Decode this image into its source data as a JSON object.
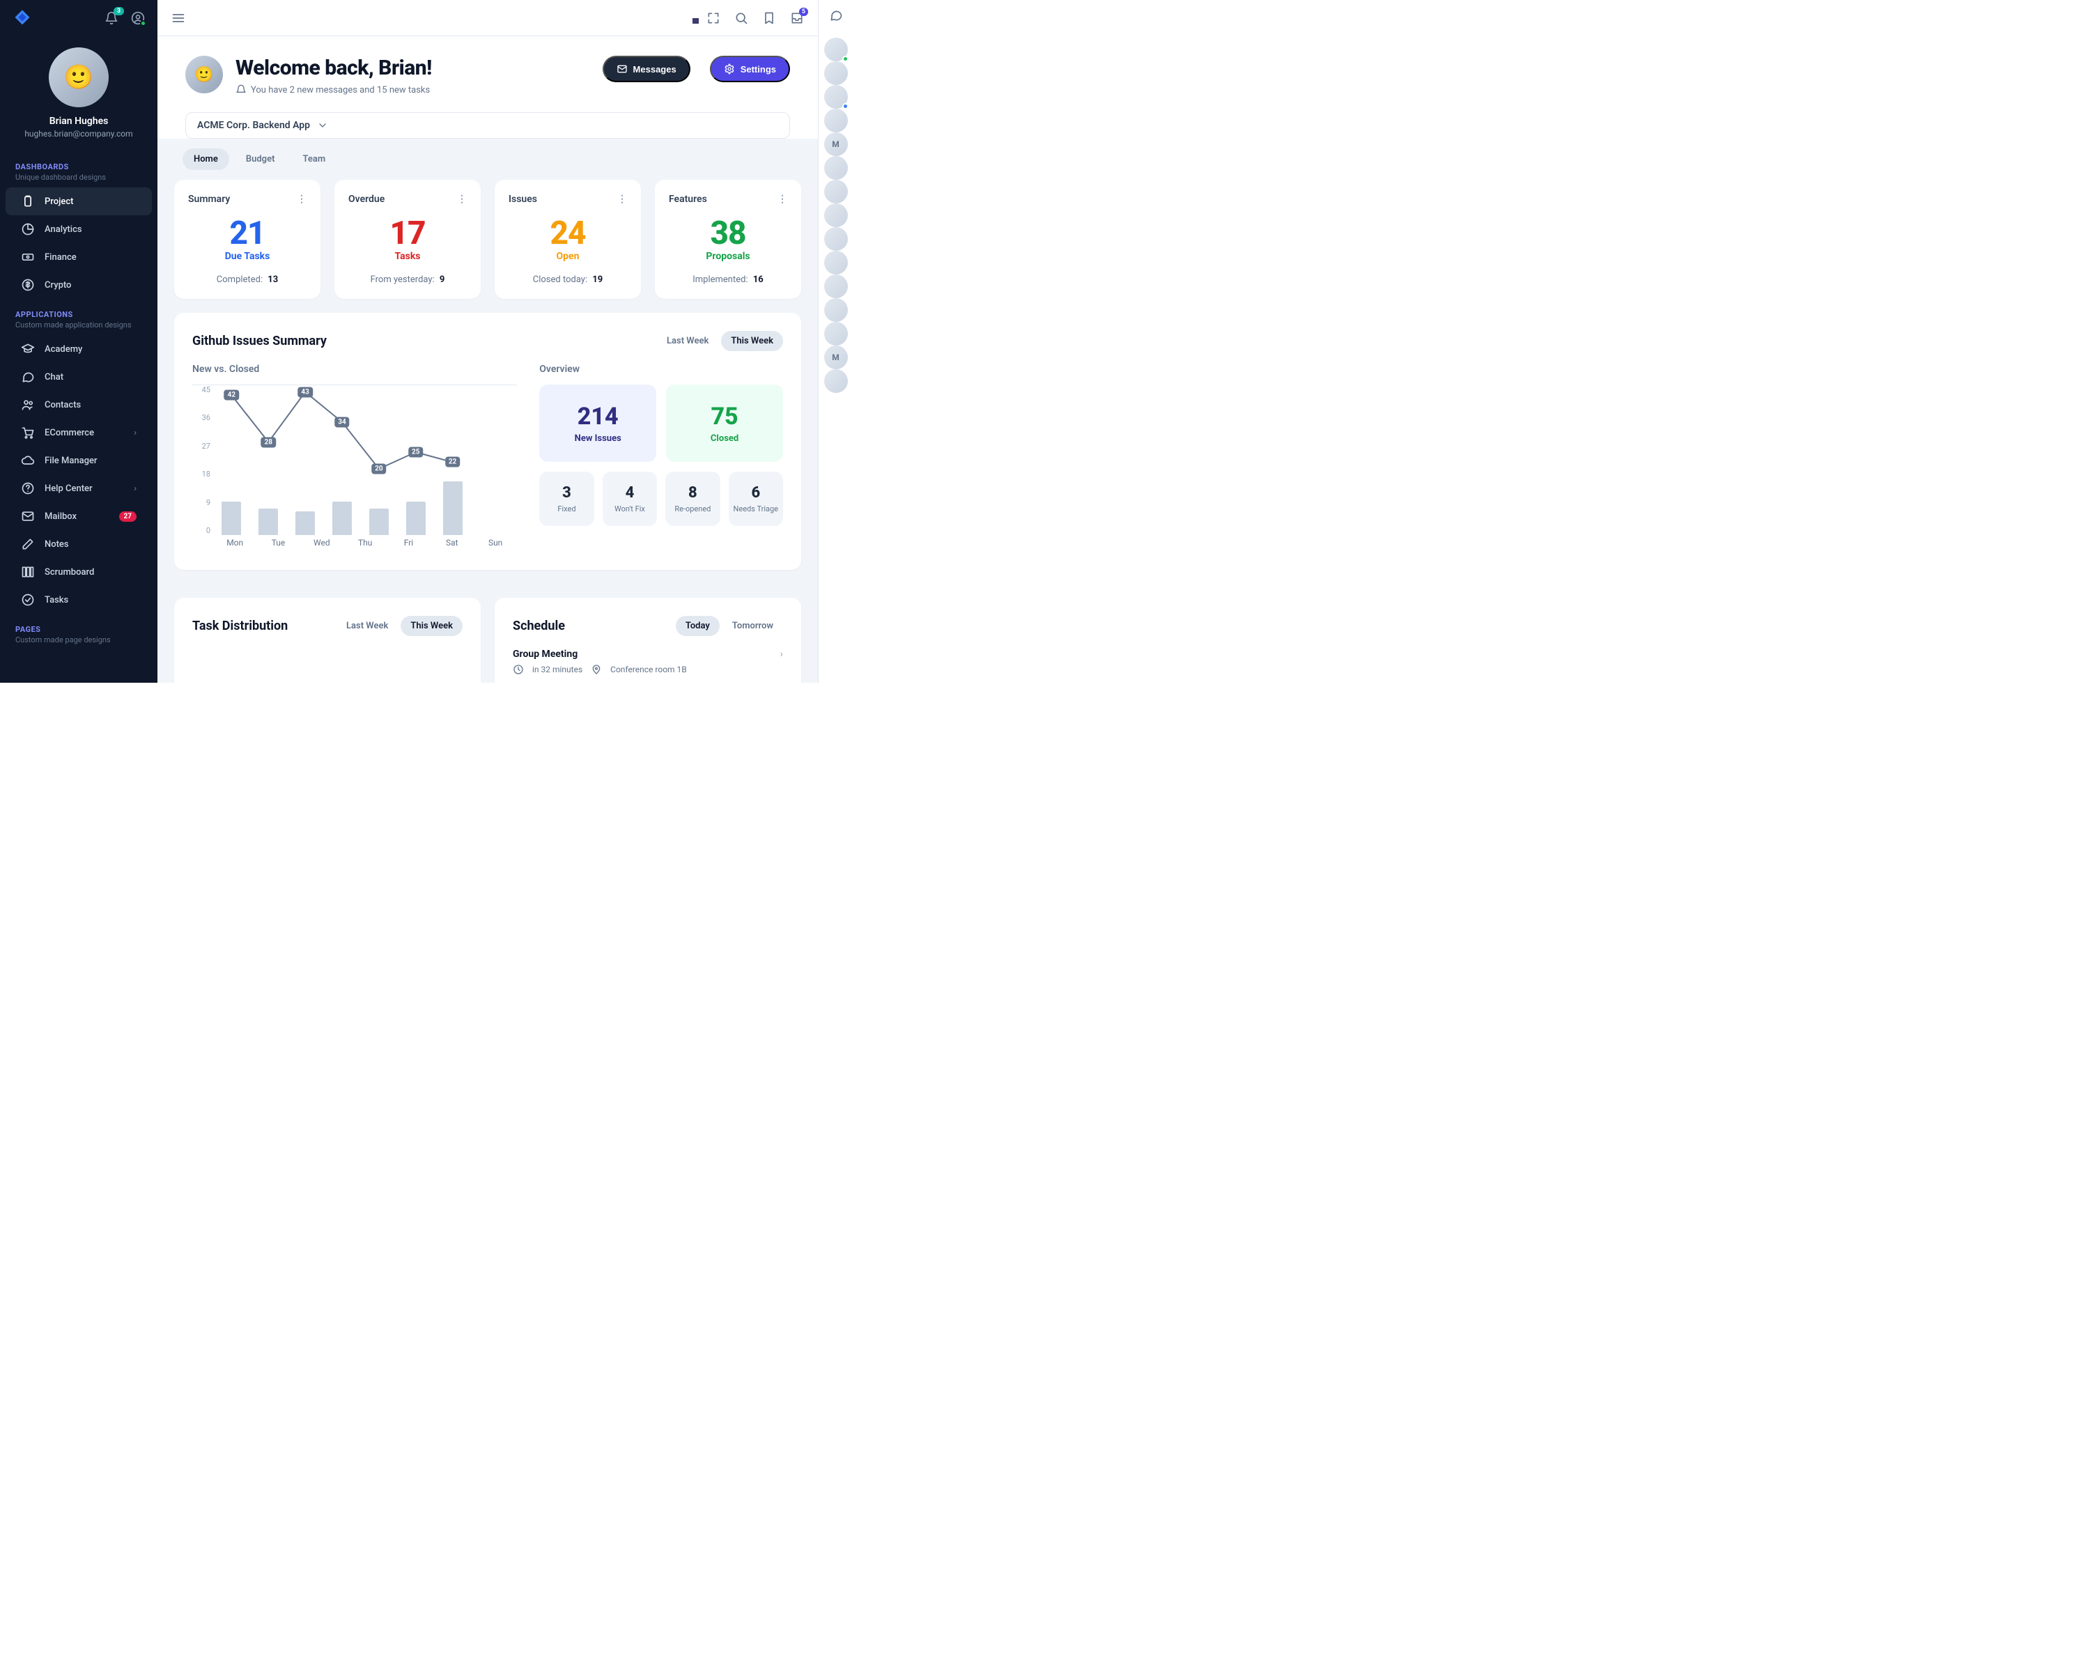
{
  "sidebar": {
    "notif_count": "3",
    "profile": {
      "name": "Brian Hughes",
      "email": "hughes.brian@company.com"
    },
    "sections": [
      {
        "title": "DASHBOARDS",
        "sub": "Unique dashboard designs",
        "items": [
          {
            "label": "Project",
            "icon": "clipboard",
            "active": true
          },
          {
            "label": "Analytics",
            "icon": "pie"
          },
          {
            "label": "Finance",
            "icon": "cash"
          },
          {
            "label": "Crypto",
            "icon": "dollar"
          }
        ]
      },
      {
        "title": "APPLICATIONS",
        "sub": "Custom made application designs",
        "items": [
          {
            "label": "Academy",
            "icon": "cap"
          },
          {
            "label": "Chat",
            "icon": "chat"
          },
          {
            "label": "Contacts",
            "icon": "users"
          },
          {
            "label": "ECommerce",
            "icon": "cart",
            "chev": true
          },
          {
            "label": "File Manager",
            "icon": "cloud"
          },
          {
            "label": "Help Center",
            "icon": "help",
            "chev": true
          },
          {
            "label": "Mailbox",
            "icon": "mail",
            "badge": "27"
          },
          {
            "label": "Notes",
            "icon": "pencil"
          },
          {
            "label": "Scrumboard",
            "icon": "columns"
          },
          {
            "label": "Tasks",
            "icon": "check"
          }
        ]
      },
      {
        "title": "PAGES",
        "sub": "Custom made page designs",
        "items": []
      }
    ]
  },
  "topbar": {
    "inbox_badge": "5"
  },
  "header": {
    "title": "Welcome back, Brian!",
    "sub": "You have 2 new messages and 15 new tasks",
    "messages_btn": "Messages",
    "settings_btn": "Settings",
    "project_selector": "ACME Corp. Backend App"
  },
  "tabs": [
    "Home",
    "Budget",
    "Team"
  ],
  "summary_cards": [
    {
      "title": "Summary",
      "value": "21",
      "label": "Due Tasks",
      "foot_label": "Completed:",
      "foot_value": "13",
      "color": "c-blue"
    },
    {
      "title": "Overdue",
      "value": "17",
      "label": "Tasks",
      "foot_label": "From yesterday:",
      "foot_value": "9",
      "color": "c-red"
    },
    {
      "title": "Issues",
      "value": "24",
      "label": "Open",
      "foot_label": "Closed today:",
      "foot_value": "19",
      "color": "c-amber"
    },
    {
      "title": "Features",
      "value": "38",
      "label": "Proposals",
      "foot_label": "Implemented:",
      "foot_value": "16",
      "color": "c-green"
    }
  ],
  "github": {
    "title": "Github Issues Summary",
    "toggle": [
      "Last Week",
      "This Week"
    ],
    "chart_title": "New vs. Closed",
    "overview_title": "Overview",
    "overview": {
      "new_issues": {
        "n": "214",
        "l": "New Issues"
      },
      "closed": {
        "n": "75",
        "l": "Closed"
      },
      "small": [
        {
          "n": "3",
          "l": "Fixed"
        },
        {
          "n": "4",
          "l": "Won't Fix"
        },
        {
          "n": "8",
          "l": "Re-opened"
        },
        {
          "n": "6",
          "l": "Needs Triage"
        }
      ]
    }
  },
  "chart_data": {
    "type": "bar+line",
    "categories": [
      "Mon",
      "Tue",
      "Wed",
      "Thu",
      "Fri",
      "Sat",
      "Sun"
    ],
    "y_ticks": [
      45,
      36,
      27,
      18,
      9,
      0
    ],
    "ylim": [
      0,
      45
    ],
    "series": [
      {
        "name": "Closed (bars)",
        "type": "bar",
        "values": [
          10,
          8,
          7,
          10,
          8,
          10,
          16
        ]
      },
      {
        "name": "New (line)",
        "type": "line",
        "values": [
          42,
          28,
          43,
          34,
          20,
          25,
          22
        ]
      }
    ]
  },
  "task_dist": {
    "title": "Task Distribution",
    "toggle": [
      "Last Week",
      "This Week"
    ]
  },
  "schedule": {
    "title": "Schedule",
    "toggle": [
      "Today",
      "Tomorrow"
    ],
    "items": [
      {
        "title": "Group Meeting",
        "time": "in 32 minutes",
        "loc": "Conference room 1B"
      }
    ]
  },
  "rail": [
    {
      "letter": "",
      "presence": "#22c55e"
    },
    {
      "letter": ""
    },
    {
      "letter": "",
      "presence": "#3b82f6"
    },
    {
      "letter": ""
    },
    {
      "letter": "M"
    },
    {
      "letter": ""
    },
    {
      "letter": ""
    },
    {
      "letter": ""
    },
    {
      "letter": ""
    },
    {
      "letter": ""
    },
    {
      "letter": ""
    },
    {
      "letter": ""
    },
    {
      "letter": ""
    },
    {
      "letter": "M"
    },
    {
      "letter": ""
    }
  ]
}
